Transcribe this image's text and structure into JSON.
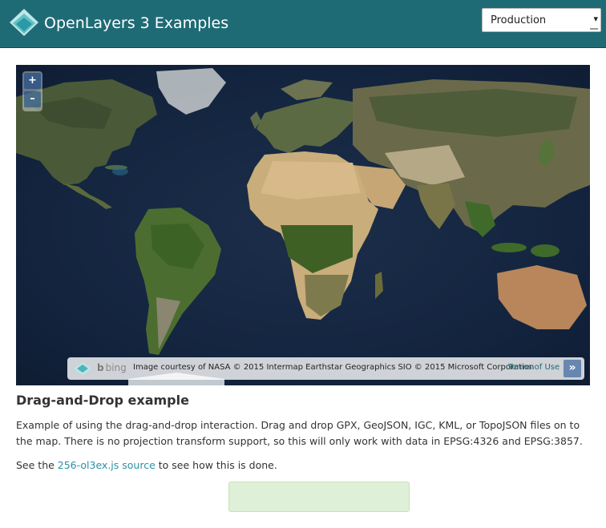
{
  "header": {
    "brand_title": "OpenLayers 3 Examples",
    "version_select": {
      "selected": "Production",
      "arrow": "▾"
    },
    "colors": {
      "navbar_bg": "#1f6b75",
      "link": "#2a91a4"
    }
  },
  "map": {
    "zoom_in_label": "+",
    "zoom_out_label": "–",
    "attribution": {
      "logo_word": "bing",
      "credit": "Image courtesy of NASA © 2015 Intermap Earthstar Geographics SIO © 2015 Microsoft Corporation",
      "terms_label": "Terms of Use",
      "collapse_label": "»"
    }
  },
  "content": {
    "title": "Drag-and-Drop example",
    "description": "Example of using the drag-and-drop interaction. Drag and drop GPX, GeoJSON, IGC, KML, or TopoJSON files on to the map. There is no projection transform support, so this will only work with data in EPSG:4326 and EPSG:3857.",
    "see_prefix": "See the ",
    "source_link": "256-ol3ex.js source",
    "see_suffix": " to see how this is done.",
    "info_box_text": ""
  }
}
